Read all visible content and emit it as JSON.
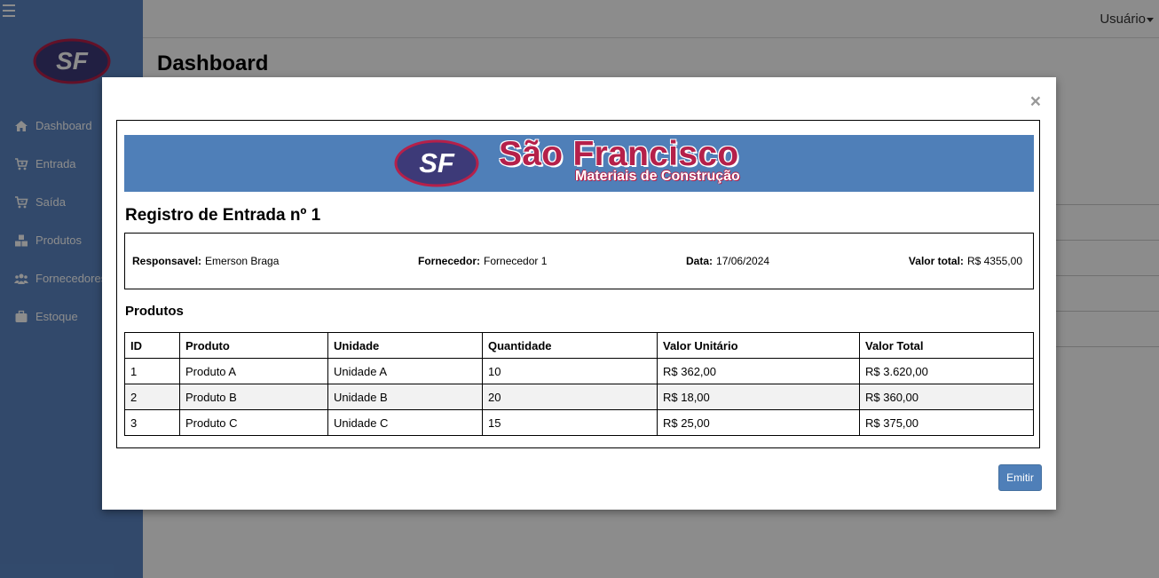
{
  "sidebar": {
    "logo_text": "SF",
    "items": [
      {
        "label": "Dashboard",
        "icon": "home-icon"
      },
      {
        "label": "Entrada",
        "icon": "cart-icon"
      },
      {
        "label": "Saída",
        "icon": "cart-icon"
      },
      {
        "label": "Produtos",
        "icon": "boxes-icon"
      },
      {
        "label": "Fornecedores",
        "icon": "users-icon"
      },
      {
        "label": "Estoque",
        "icon": "briefcase-icon"
      }
    ]
  },
  "topbar": {
    "user_label": "Usuário"
  },
  "page": {
    "title": "Dashboard"
  },
  "modal": {
    "close_label": "×",
    "banner": {
      "logo_text": "SF",
      "company_name": "São Francisco",
      "company_subtitle": "Materiais de Construção"
    },
    "title": "Registro de Entrada nº 1",
    "info": {
      "responsavel_label": "Responsavel:",
      "responsavel_value": "Emerson Braga",
      "fornecedor_label": "Fornecedor:",
      "fornecedor_value": "Fornecedor 1",
      "data_label": "Data:",
      "data_value": "17/06/2024",
      "valor_total_label": "Valor total:",
      "valor_total_value": "R$ 4355,00"
    },
    "products_heading": "Produtos",
    "table": {
      "headers": [
        "ID",
        "Produto",
        "Unidade",
        "Quantidade",
        "Valor Unitário",
        "Valor Total"
      ],
      "rows": [
        [
          "1",
          "Produto A",
          "Unidade A",
          "10",
          "R$ 362,00",
          "R$ 3.620,00"
        ],
        [
          "2",
          "Produto B",
          "Unidade B",
          "20",
          "R$ 18,00",
          "R$ 360,00"
        ],
        [
          "3",
          "Produto C",
          "Unidade C",
          "15",
          "R$ 25,00",
          "R$ 375,00"
        ]
      ]
    },
    "emit_label": "Emitir"
  },
  "colors": {
    "sidebar": "#5b86c4",
    "banner": "#4f7fb8",
    "brand_red": "#b5204a",
    "logo_purple": "#3d3a78",
    "button": "#4f7fb8"
  }
}
